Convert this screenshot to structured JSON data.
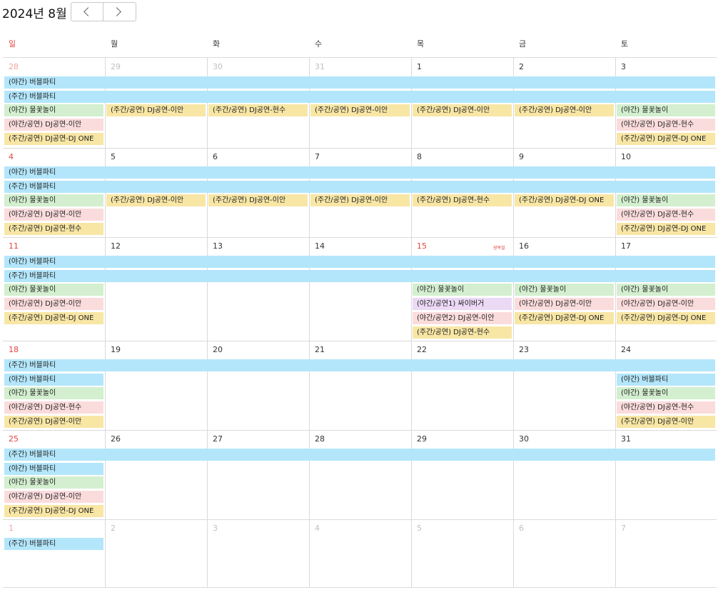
{
  "header": {
    "title": "2024년 8월",
    "prev_icon": "chevron-left-icon",
    "next_icon": "chevron-right-icon"
  },
  "weekdays": [
    "일",
    "월",
    "화",
    "수",
    "목",
    "금",
    "토"
  ],
  "colors": {
    "sunday": "#e0463f",
    "blue": "#b3e6fa",
    "green": "#d3efcf",
    "pink": "#fbdcdc",
    "yellow": "#f8e6a5",
    "purple": "#ecd9f6"
  },
  "weeks": [
    {
      "days": [
        "28",
        "29",
        "30",
        "31",
        "1",
        "2",
        "3"
      ],
      "other": [
        true,
        true,
        true,
        true,
        false,
        false,
        false
      ],
      "spans": [
        {
          "label": "(야간) 버블파티",
          "color": "blue",
          "start": 0,
          "end": 6,
          "row": 0
        },
        {
          "label": "(주간) 버블파티",
          "color": "blue",
          "start": 0,
          "end": 6,
          "row": 1
        },
        {
          "label": "(야간) 물꽃놀이",
          "color": "green",
          "start": 0,
          "end": 0,
          "row": 2
        },
        {
          "label": "(야간/공연) DJ공연-이안",
          "color": "pink",
          "start": 0,
          "end": 0,
          "row": 3
        },
        {
          "label": "(주간/공연) DJ공연-DJ ONE",
          "color": "yellow",
          "start": 0,
          "end": 0,
          "row": 4
        },
        {
          "label": "(주간/공연) DJ공연-이안",
          "color": "yellow",
          "start": 1,
          "end": 1,
          "row": 2
        },
        {
          "label": "(주간/공연) DJ공연-현수",
          "color": "yellow",
          "start": 2,
          "end": 2,
          "row": 2
        },
        {
          "label": "(주간/공연) DJ공연-이안",
          "color": "yellow",
          "start": 3,
          "end": 3,
          "row": 2
        },
        {
          "label": "(주간/공연) DJ공연-이안",
          "color": "yellow",
          "start": 4,
          "end": 4,
          "row": 2
        },
        {
          "label": "(주간/공연) DJ공연-이안",
          "color": "yellow",
          "start": 5,
          "end": 5,
          "row": 2
        },
        {
          "label": "(야간) 물꽃놀이",
          "color": "green",
          "start": 6,
          "end": 6,
          "row": 2
        },
        {
          "label": "(야간/공연) DJ공연-현수",
          "color": "pink",
          "start": 6,
          "end": 6,
          "row": 3
        },
        {
          "label": "(주간/공연) DJ공연-DJ ONE",
          "color": "yellow",
          "start": 6,
          "end": 6,
          "row": 4
        }
      ]
    },
    {
      "days": [
        "4",
        "5",
        "6",
        "7",
        "8",
        "9",
        "10"
      ],
      "other": [
        false,
        false,
        false,
        false,
        false,
        false,
        false
      ],
      "spans": [
        {
          "label": "(야간) 버블파티",
          "color": "blue",
          "start": 0,
          "end": 6,
          "row": 0
        },
        {
          "label": "(주간) 버블파티",
          "color": "blue",
          "start": 0,
          "end": 6,
          "row": 1
        },
        {
          "label": "(야간) 물꽃놀이",
          "color": "green",
          "start": 0,
          "end": 0,
          "row": 2
        },
        {
          "label": "(야간/공연) DJ공연-이안",
          "color": "pink",
          "start": 0,
          "end": 0,
          "row": 3
        },
        {
          "label": "(주간/공연) DJ공연-현수",
          "color": "yellow",
          "start": 0,
          "end": 0,
          "row": 4
        },
        {
          "label": "(주간/공연) DJ공연-이안",
          "color": "yellow",
          "start": 1,
          "end": 1,
          "row": 2
        },
        {
          "label": "(주간/공연) DJ공연-이안",
          "color": "yellow",
          "start": 2,
          "end": 2,
          "row": 2
        },
        {
          "label": "(주간/공연) DJ공연-이안",
          "color": "yellow",
          "start": 3,
          "end": 3,
          "row": 2
        },
        {
          "label": "(주간/공연) DJ공연-현수",
          "color": "yellow",
          "start": 4,
          "end": 4,
          "row": 2
        },
        {
          "label": "(주간/공연) DJ공연-DJ ONE",
          "color": "yellow",
          "start": 5,
          "end": 5,
          "row": 2
        },
        {
          "label": "(야간) 물꽃놀이",
          "color": "green",
          "start": 6,
          "end": 6,
          "row": 2
        },
        {
          "label": "(야간/공연) DJ공연-현수",
          "color": "pink",
          "start": 6,
          "end": 6,
          "row": 3
        },
        {
          "label": "(주간/공연) DJ공연-DJ ONE",
          "color": "yellow",
          "start": 6,
          "end": 6,
          "row": 4
        }
      ]
    },
    {
      "days": [
        "11",
        "12",
        "13",
        "14",
        "15",
        "16",
        "17"
      ],
      "other": [
        false,
        false,
        false,
        false,
        false,
        false,
        false
      ],
      "holiday_index": 4,
      "holiday_label": "광복절",
      "spans": [
        {
          "label": "(야간) 버블파티",
          "color": "blue",
          "start": 0,
          "end": 6,
          "row": 0
        },
        {
          "label": "(주간) 버블파티",
          "color": "blue",
          "start": 0,
          "end": 6,
          "row": 1
        },
        {
          "label": "(야간) 물꽃놀이",
          "color": "green",
          "start": 0,
          "end": 0,
          "row": 2
        },
        {
          "label": "(야간/공연) DJ공연-이안",
          "color": "pink",
          "start": 0,
          "end": 0,
          "row": 3
        },
        {
          "label": "(주간/공연) DJ공연-DJ ONE",
          "color": "yellow",
          "start": 0,
          "end": 0,
          "row": 4
        },
        {
          "label": "(야간) 물꽃놀이",
          "color": "green",
          "start": 4,
          "end": 4,
          "row": 2
        },
        {
          "label": "(야간/공연1) 싸이버거",
          "color": "purple",
          "start": 4,
          "end": 4,
          "row": 3
        },
        {
          "label": "(야간/공연2) DJ공연-이안",
          "color": "pink",
          "start": 4,
          "end": 4,
          "row": 4
        },
        {
          "label": "(주간/공연) DJ공연-현수",
          "color": "yellow",
          "start": 4,
          "end": 4,
          "row": 5
        },
        {
          "label": "(야간) 물꽃놀이",
          "color": "green",
          "start": 5,
          "end": 5,
          "row": 2
        },
        {
          "label": "(야간/공연) DJ공연-이안",
          "color": "pink",
          "start": 5,
          "end": 5,
          "row": 3
        },
        {
          "label": "(주간/공연) DJ공연-DJ ONE",
          "color": "yellow",
          "start": 5,
          "end": 5,
          "row": 4
        },
        {
          "label": "(야간) 물꽃놀이",
          "color": "green",
          "start": 6,
          "end": 6,
          "row": 2
        },
        {
          "label": "(야간/공연) DJ공연-이안",
          "color": "pink",
          "start": 6,
          "end": 6,
          "row": 3
        },
        {
          "label": "(주간/공연) DJ공연-DJ ONE",
          "color": "yellow",
          "start": 6,
          "end": 6,
          "row": 4
        }
      ]
    },
    {
      "days": [
        "18",
        "19",
        "20",
        "21",
        "22",
        "23",
        "24"
      ],
      "other": [
        false,
        false,
        false,
        false,
        false,
        false,
        false
      ],
      "spans": [
        {
          "label": "(주간) 버블파티",
          "color": "blue",
          "start": 0,
          "end": 6,
          "row": 0
        },
        {
          "label": "(야간) 버블파티",
          "color": "blue",
          "start": 0,
          "end": 0,
          "row": 1
        },
        {
          "label": "(야간) 물꽃놀이",
          "color": "green",
          "start": 0,
          "end": 0,
          "row": 2
        },
        {
          "label": "(야간/공연) DJ공연-현수",
          "color": "pink",
          "start": 0,
          "end": 0,
          "row": 3
        },
        {
          "label": "(주간/공연) DJ공연-이안",
          "color": "yellow",
          "start": 0,
          "end": 0,
          "row": 4
        },
        {
          "label": "(야간) 버블파티",
          "color": "blue",
          "start": 6,
          "end": 6,
          "row": 1
        },
        {
          "label": "(야간) 물꽃놀이",
          "color": "green",
          "start": 6,
          "end": 6,
          "row": 2
        },
        {
          "label": "(야간/공연) DJ공연-현수",
          "color": "pink",
          "start": 6,
          "end": 6,
          "row": 3
        },
        {
          "label": "(주간/공연) DJ공연-이안",
          "color": "yellow",
          "start": 6,
          "end": 6,
          "row": 4
        }
      ]
    },
    {
      "days": [
        "25",
        "26",
        "27",
        "28",
        "29",
        "30",
        "31"
      ],
      "other": [
        false,
        false,
        false,
        false,
        false,
        false,
        false
      ],
      "spans": [
        {
          "label": "(주간) 버블파티",
          "color": "blue",
          "start": 0,
          "end": 6,
          "row": 0
        },
        {
          "label": "(야간) 버블파티",
          "color": "blue",
          "start": 0,
          "end": 0,
          "row": 1
        },
        {
          "label": "(야간) 물꽃놀이",
          "color": "green",
          "start": 0,
          "end": 0,
          "row": 2
        },
        {
          "label": "(야간/공연) DJ공연-이안",
          "color": "pink",
          "start": 0,
          "end": 0,
          "row": 3
        },
        {
          "label": "(주간/공연) DJ공연-DJ ONE",
          "color": "yellow",
          "start": 0,
          "end": 0,
          "row": 4
        }
      ]
    },
    {
      "days": [
        "1",
        "2",
        "3",
        "4",
        "5",
        "6",
        "7"
      ],
      "other": [
        true,
        true,
        true,
        true,
        true,
        true,
        true
      ],
      "spans": [
        {
          "label": "(주간) 버블파티",
          "color": "blue",
          "start": 0,
          "end": 0,
          "row": 0
        }
      ]
    }
  ]
}
